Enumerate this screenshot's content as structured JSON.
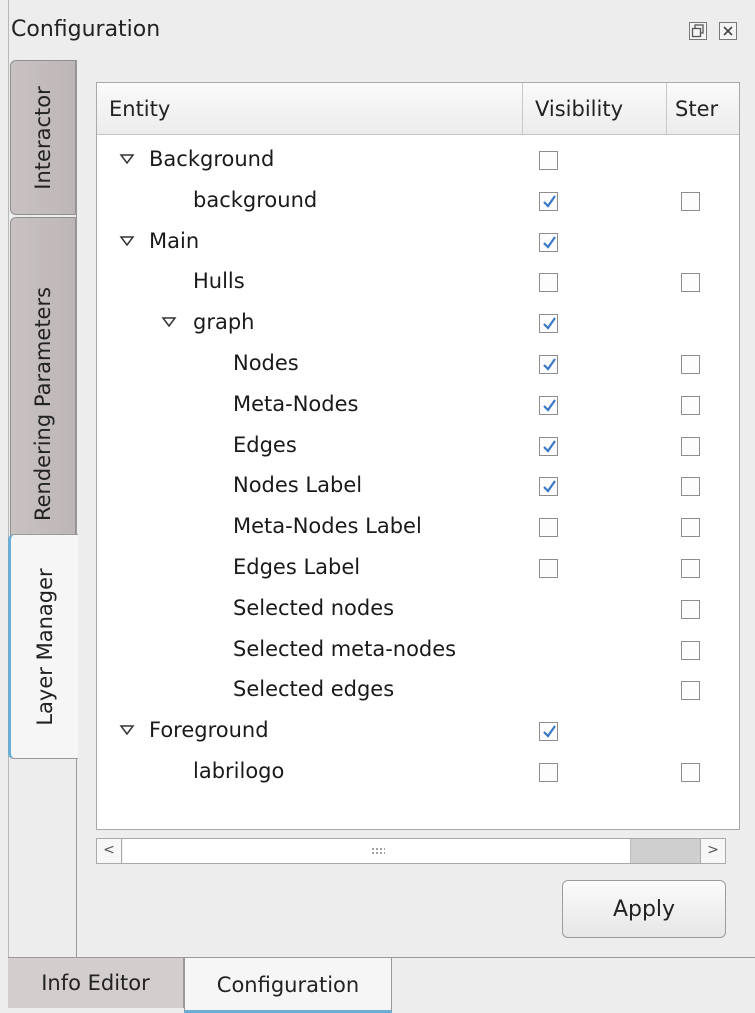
{
  "window": {
    "title": "Configuration",
    "float_icon": "float-icon",
    "close_icon": "close-icon"
  },
  "side_tabs": [
    {
      "label": "Interactor",
      "active": false
    },
    {
      "label": "Rendering Parameters",
      "active": false
    },
    {
      "label": "Layer Manager",
      "active": true
    }
  ],
  "tree": {
    "columns": [
      "Entity",
      "Visibility",
      "Ster"
    ],
    "rows": [
      {
        "label": "Background",
        "level": 0,
        "expandable": true,
        "visibility": false,
        "stencil": null
      },
      {
        "label": "background",
        "level": 1,
        "expandable": false,
        "visibility": true,
        "stencil": false
      },
      {
        "label": "Main",
        "level": 0,
        "expandable": true,
        "visibility": true,
        "stencil": null
      },
      {
        "label": "Hulls",
        "level": 1,
        "expandable": false,
        "visibility": false,
        "stencil": false
      },
      {
        "label": "graph",
        "level": 1,
        "expandable": true,
        "visibility": true,
        "stencil": null
      },
      {
        "label": "Nodes",
        "level": 2,
        "expandable": false,
        "visibility": true,
        "stencil": false
      },
      {
        "label": "Meta-Nodes",
        "level": 2,
        "expandable": false,
        "visibility": true,
        "stencil": false
      },
      {
        "label": "Edges",
        "level": 2,
        "expandable": false,
        "visibility": true,
        "stencil": false
      },
      {
        "label": "Nodes Label",
        "level": 2,
        "expandable": false,
        "visibility": true,
        "stencil": false
      },
      {
        "label": "Meta-Nodes Label",
        "level": 2,
        "expandable": false,
        "visibility": false,
        "stencil": false
      },
      {
        "label": "Edges Label",
        "level": 2,
        "expandable": false,
        "visibility": false,
        "stencil": false
      },
      {
        "label": "Selected nodes",
        "level": 2,
        "expandable": false,
        "visibility": null,
        "stencil": false
      },
      {
        "label": "Selected meta-nodes",
        "level": 2,
        "expandable": false,
        "visibility": null,
        "stencil": false
      },
      {
        "label": "Selected edges",
        "level": 2,
        "expandable": false,
        "visibility": null,
        "stencil": false
      },
      {
        "label": "Foreground",
        "level": 0,
        "expandable": true,
        "visibility": true,
        "stencil": null
      },
      {
        "label": "labrilogo",
        "level": 1,
        "expandable": false,
        "visibility": false,
        "stencil": false
      }
    ]
  },
  "scrollbar": {
    "left_arrow": "<",
    "right_arrow": ">"
  },
  "apply_label": "Apply",
  "bottom_tabs": [
    {
      "label": "Info Editor",
      "active": false
    },
    {
      "label": "Configuration",
      "active": true
    }
  ],
  "colors": {
    "check": "#3a78c9",
    "active_tab_accent": "#6aaed6"
  }
}
